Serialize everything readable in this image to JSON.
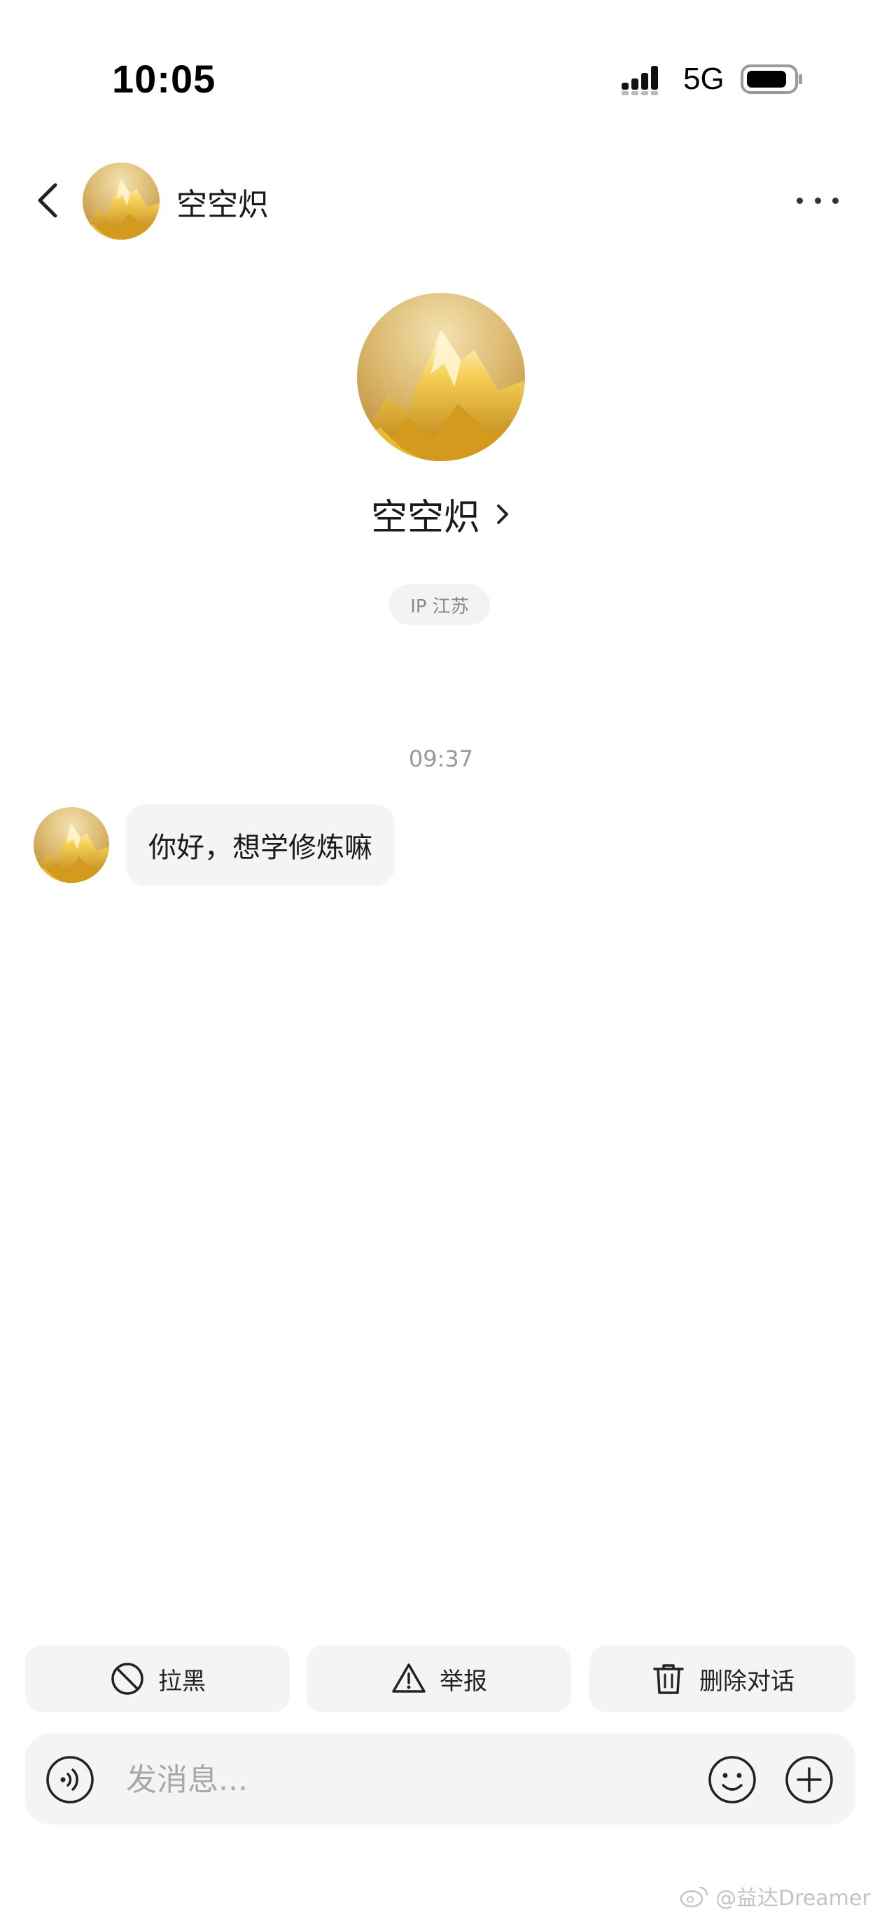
{
  "status_bar": {
    "time": "10:05",
    "network": "5G"
  },
  "header": {
    "name": "空空炽"
  },
  "profile": {
    "name": "空空炽",
    "ip_location": "IP 江苏"
  },
  "chat": {
    "timestamp": "09:37",
    "messages": [
      {
        "text": "你好，想学修炼嘛"
      }
    ]
  },
  "actions": {
    "block_label": "拉黑",
    "report_label": "举报",
    "delete_label": "删除对话"
  },
  "input": {
    "placeholder": "发消息..."
  },
  "watermark": {
    "text": "@益达Dreamer"
  },
  "icons": {
    "back": "chevron-left-icon",
    "more": "more-icon",
    "block": "block-icon",
    "report": "warning-icon",
    "delete": "trash-icon",
    "voice": "voice-icon",
    "emoji": "emoji-icon",
    "plus": "plus-icon"
  },
  "colors": {
    "background": "#ffffff",
    "bubble": "#f4f4f4",
    "muted_text": "#999999",
    "avatar_gold": "#d9a93a"
  }
}
